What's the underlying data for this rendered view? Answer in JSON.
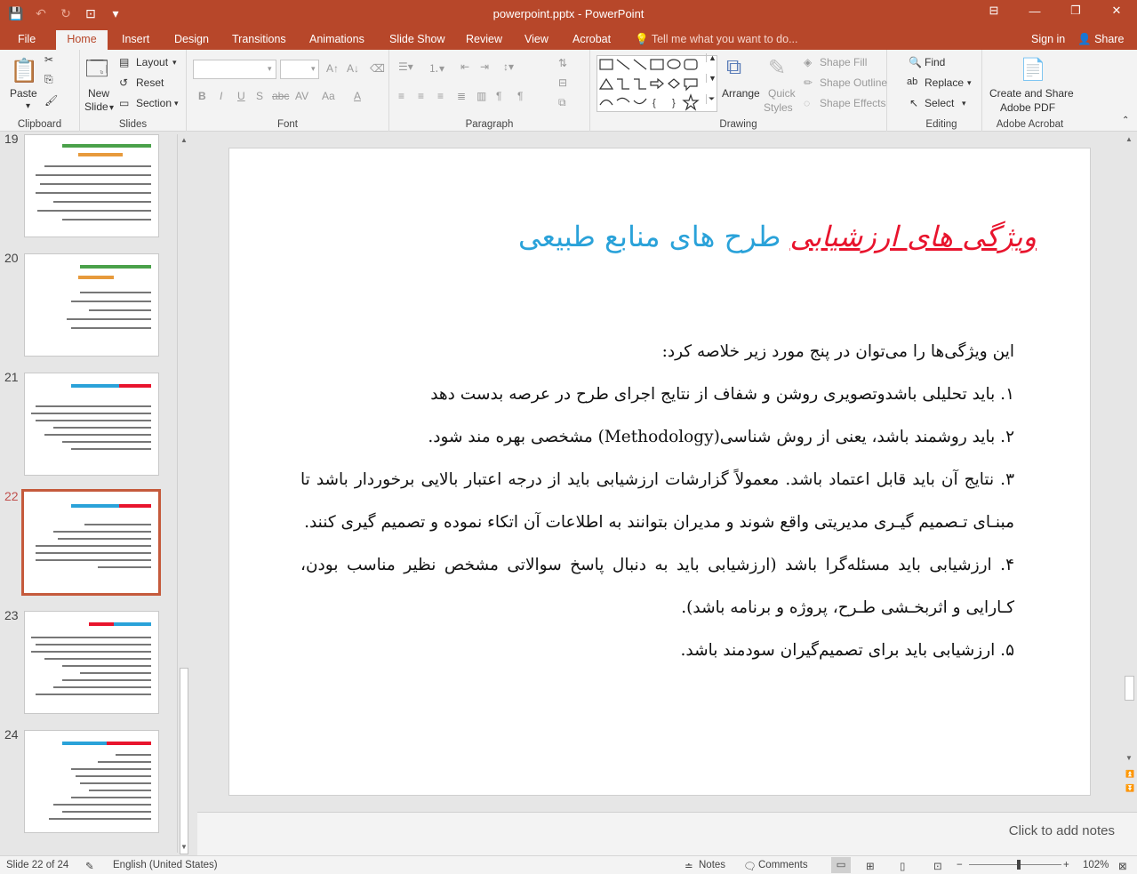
{
  "window": {
    "title": "powerpoint.pptx - PowerPoint",
    "minimize_icon": "—",
    "restore_icon": "❐",
    "close_icon": "✕"
  },
  "tabs": [
    "File",
    "Home",
    "Insert",
    "Design",
    "Transitions",
    "Animations",
    "Slide Show",
    "Review",
    "View",
    "Acrobat"
  ],
  "tell_me": "Tell me what you want to do...",
  "sign_in": "Sign in",
  "share": "Share",
  "ribbon": {
    "clipboard": {
      "label": "Clipboard",
      "paste": "Paste"
    },
    "slides": {
      "label": "Slides",
      "new_slide_1": "New",
      "new_slide_2": "Slide",
      "layout": "Layout",
      "reset": "Reset",
      "section": "Section"
    },
    "font": {
      "label": "Font",
      "bold": "B",
      "italic": "I",
      "underline": "U",
      "strike": "S",
      "abc": "abc",
      "av": "AV",
      "aa": "Aa",
      "a": "A"
    },
    "paragraph": {
      "label": "Paragraph"
    },
    "drawing": {
      "label": "Drawing",
      "arrange": "Arrange",
      "quick_styles_1": "Quick",
      "quick_styles_2": "Styles",
      "shape_fill": "Shape Fill",
      "shape_outline": "Shape Outline",
      "shape_effects": "Shape Effects"
    },
    "editing": {
      "label": "Editing",
      "find": "Find",
      "replace": "Replace",
      "select": "Select"
    },
    "acrobat": {
      "label": "Adobe Acrobat",
      "create_1": "Create and Share",
      "create_2": "Adobe PDF"
    }
  },
  "thumbnails": [
    {
      "num": "19",
      "active": false
    },
    {
      "num": "20",
      "active": false
    },
    {
      "num": "21",
      "active": false
    },
    {
      "num": "22",
      "active": true
    },
    {
      "num": "23",
      "active": false
    },
    {
      "num": "24",
      "active": false
    }
  ],
  "slide": {
    "title_red": "ویژگی های ارزشیابی",
    "title_blue": " طرح های منابع طبیعی",
    "intro": "این ویژگی‌ها را می‌توان در پنج مورد زیر خلاصه کرد:",
    "items": [
      "۱.  باید تحلیلی باشدوتصویری روشن و شفاف از نتایج اجرای طرح در عرصه بدست دهد",
      "۲.  باید روشمند باشد، یعنی از روش شناسی(Methodology) مشخصی بهره مند شود.",
      "۳.  نتایج آن باید قابل اعتماد باشد. معمولاً گزارشات ارزشیابی باید از درجه اعتبار بالایی برخوردار باشد تا مبنـای تـصمیم گیـری مدیریتی واقع شوند و مدیران بتوانند به اطلاعات آن اتکاء نموده و تصمیم گیری کنند.",
      "۴.  ارزشیابی باید مسئله‌گرا باشد (ارزشیابی باید به دنبال پاسخ سوالاتی مشخص نظیر مناسب بودن، کـارایی و اثربخـشی طـرح، پروژه و برنامه باشد).",
      "۵.  ارزشیابی باید برای تصمیم‌گیران سودمند باشد."
    ]
  },
  "notes_placeholder": "Click to add notes",
  "status": {
    "slide_info": "Slide 22 of 24",
    "language": "English (United States)",
    "notes": "Notes",
    "comments": "Comments",
    "zoom": "102%"
  }
}
